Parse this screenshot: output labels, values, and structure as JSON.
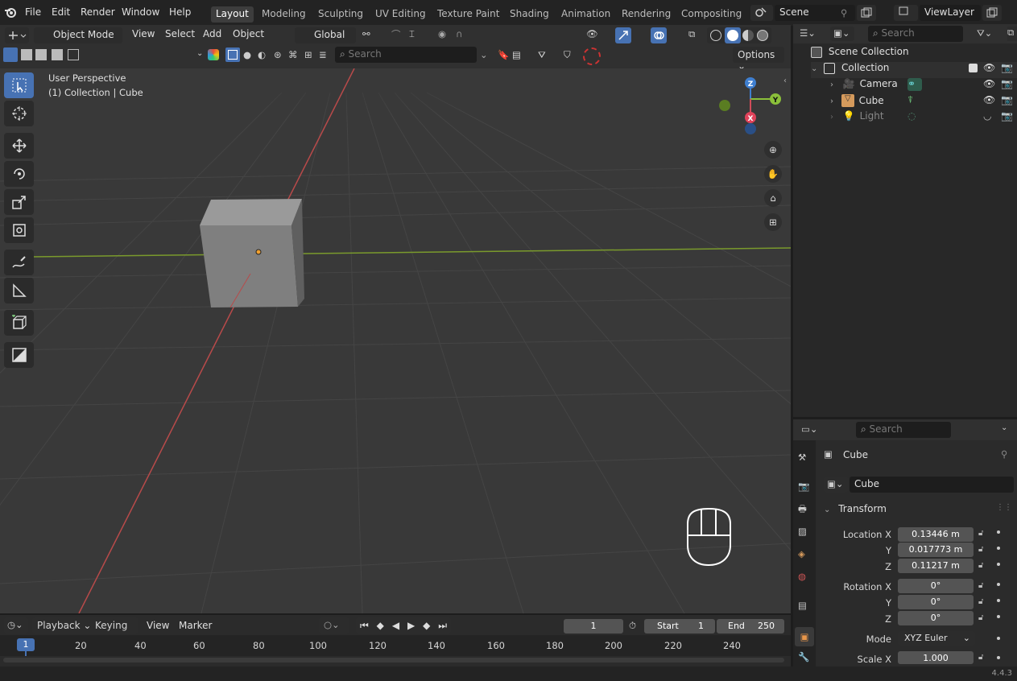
{
  "menu": [
    "File",
    "Edit",
    "Render",
    "Window",
    "Help"
  ],
  "workspaces": [
    "Layout",
    "Modeling",
    "Sculpting",
    "UV Editing",
    "Texture Paint",
    "Shading",
    "Animation",
    "Rendering",
    "Compositing"
  ],
  "active_workspace": "Layout",
  "scene": {
    "name": "Scene"
  },
  "view_layer": {
    "name": "ViewLayer"
  },
  "viewport_header": {
    "mode": "Object Mode",
    "view": "View",
    "select": "Select",
    "add": "Add",
    "object": "Object",
    "orientation": "Global",
    "search_placeholder": "Search",
    "options": "Options"
  },
  "viewport": {
    "title": "User Perspective",
    "subtitle": "(1) Collection | Cube"
  },
  "gizmo": {
    "x": "X",
    "y": "Y",
    "z": "Z"
  },
  "outliner": {
    "search_placeholder": "Search",
    "scene_collection": "Scene Collection",
    "collection": "Collection",
    "items": [
      {
        "name": "Camera"
      },
      {
        "name": "Cube"
      },
      {
        "name": "Light"
      }
    ]
  },
  "properties": {
    "search_placeholder": "Search",
    "object_name": "Cube",
    "data_name": "Cube",
    "transform_label": "Transform",
    "location_label": "Location X",
    "y_label": "Y",
    "z_label": "Z",
    "location": [
      "0.13446 m",
      "0.017773 m",
      "0.11217 m"
    ],
    "rotation_label": "Rotation X",
    "rotation": [
      "0°",
      "0°",
      "0°"
    ],
    "mode_label": "Mode",
    "mode_value": "XYZ Euler",
    "scale_label": "Scale X",
    "scale_x": "1.000"
  },
  "timeline": {
    "playback": "Playback",
    "keying": "Keying",
    "view": "View",
    "marker": "Marker",
    "current_frame": "1",
    "start_label": "Start",
    "start": "1",
    "end_label": "End",
    "end": "250",
    "ruler": [
      "20",
      "40",
      "60",
      "80",
      "100",
      "120",
      "140",
      "160",
      "180",
      "200",
      "220",
      "240"
    ],
    "playhead": "1"
  },
  "status": {
    "version": "4.4.3"
  }
}
